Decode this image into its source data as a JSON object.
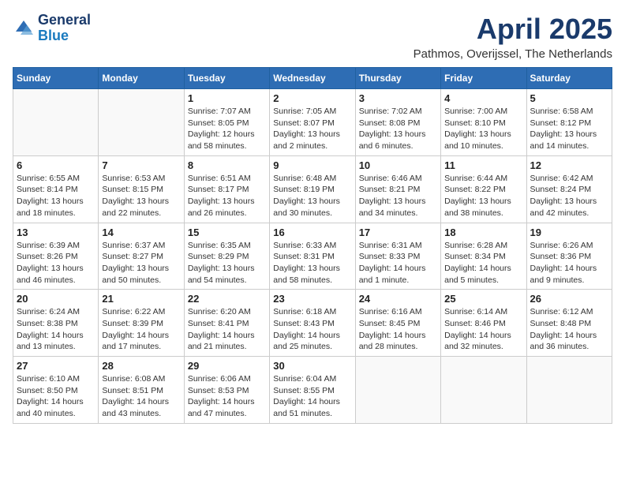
{
  "logo": {
    "line1": "General",
    "line2": "Blue"
  },
  "title": "April 2025",
  "subtitle": "Pathmos, Overijssel, The Netherlands",
  "weekdays": [
    "Sunday",
    "Monday",
    "Tuesday",
    "Wednesday",
    "Thursday",
    "Friday",
    "Saturday"
  ],
  "weeks": [
    [
      {
        "day": "",
        "info": ""
      },
      {
        "day": "",
        "info": ""
      },
      {
        "day": "1",
        "info": "Sunrise: 7:07 AM\nSunset: 8:05 PM\nDaylight: 12 hours and 58 minutes."
      },
      {
        "day": "2",
        "info": "Sunrise: 7:05 AM\nSunset: 8:07 PM\nDaylight: 13 hours and 2 minutes."
      },
      {
        "day": "3",
        "info": "Sunrise: 7:02 AM\nSunset: 8:08 PM\nDaylight: 13 hours and 6 minutes."
      },
      {
        "day": "4",
        "info": "Sunrise: 7:00 AM\nSunset: 8:10 PM\nDaylight: 13 hours and 10 minutes."
      },
      {
        "day": "5",
        "info": "Sunrise: 6:58 AM\nSunset: 8:12 PM\nDaylight: 13 hours and 14 minutes."
      }
    ],
    [
      {
        "day": "6",
        "info": "Sunrise: 6:55 AM\nSunset: 8:14 PM\nDaylight: 13 hours and 18 minutes."
      },
      {
        "day": "7",
        "info": "Sunrise: 6:53 AM\nSunset: 8:15 PM\nDaylight: 13 hours and 22 minutes."
      },
      {
        "day": "8",
        "info": "Sunrise: 6:51 AM\nSunset: 8:17 PM\nDaylight: 13 hours and 26 minutes."
      },
      {
        "day": "9",
        "info": "Sunrise: 6:48 AM\nSunset: 8:19 PM\nDaylight: 13 hours and 30 minutes."
      },
      {
        "day": "10",
        "info": "Sunrise: 6:46 AM\nSunset: 8:21 PM\nDaylight: 13 hours and 34 minutes."
      },
      {
        "day": "11",
        "info": "Sunrise: 6:44 AM\nSunset: 8:22 PM\nDaylight: 13 hours and 38 minutes."
      },
      {
        "day": "12",
        "info": "Sunrise: 6:42 AM\nSunset: 8:24 PM\nDaylight: 13 hours and 42 minutes."
      }
    ],
    [
      {
        "day": "13",
        "info": "Sunrise: 6:39 AM\nSunset: 8:26 PM\nDaylight: 13 hours and 46 minutes."
      },
      {
        "day": "14",
        "info": "Sunrise: 6:37 AM\nSunset: 8:27 PM\nDaylight: 13 hours and 50 minutes."
      },
      {
        "day": "15",
        "info": "Sunrise: 6:35 AM\nSunset: 8:29 PM\nDaylight: 13 hours and 54 minutes."
      },
      {
        "day": "16",
        "info": "Sunrise: 6:33 AM\nSunset: 8:31 PM\nDaylight: 13 hours and 58 minutes."
      },
      {
        "day": "17",
        "info": "Sunrise: 6:31 AM\nSunset: 8:33 PM\nDaylight: 14 hours and 1 minute."
      },
      {
        "day": "18",
        "info": "Sunrise: 6:28 AM\nSunset: 8:34 PM\nDaylight: 14 hours and 5 minutes."
      },
      {
        "day": "19",
        "info": "Sunrise: 6:26 AM\nSunset: 8:36 PM\nDaylight: 14 hours and 9 minutes."
      }
    ],
    [
      {
        "day": "20",
        "info": "Sunrise: 6:24 AM\nSunset: 8:38 PM\nDaylight: 14 hours and 13 minutes."
      },
      {
        "day": "21",
        "info": "Sunrise: 6:22 AM\nSunset: 8:39 PM\nDaylight: 14 hours and 17 minutes."
      },
      {
        "day": "22",
        "info": "Sunrise: 6:20 AM\nSunset: 8:41 PM\nDaylight: 14 hours and 21 minutes."
      },
      {
        "day": "23",
        "info": "Sunrise: 6:18 AM\nSunset: 8:43 PM\nDaylight: 14 hours and 25 minutes."
      },
      {
        "day": "24",
        "info": "Sunrise: 6:16 AM\nSunset: 8:45 PM\nDaylight: 14 hours and 28 minutes."
      },
      {
        "day": "25",
        "info": "Sunrise: 6:14 AM\nSunset: 8:46 PM\nDaylight: 14 hours and 32 minutes."
      },
      {
        "day": "26",
        "info": "Sunrise: 6:12 AM\nSunset: 8:48 PM\nDaylight: 14 hours and 36 minutes."
      }
    ],
    [
      {
        "day": "27",
        "info": "Sunrise: 6:10 AM\nSunset: 8:50 PM\nDaylight: 14 hours and 40 minutes."
      },
      {
        "day": "28",
        "info": "Sunrise: 6:08 AM\nSunset: 8:51 PM\nDaylight: 14 hours and 43 minutes."
      },
      {
        "day": "29",
        "info": "Sunrise: 6:06 AM\nSunset: 8:53 PM\nDaylight: 14 hours and 47 minutes."
      },
      {
        "day": "30",
        "info": "Sunrise: 6:04 AM\nSunset: 8:55 PM\nDaylight: 14 hours and 51 minutes."
      },
      {
        "day": "",
        "info": ""
      },
      {
        "day": "",
        "info": ""
      },
      {
        "day": "",
        "info": ""
      }
    ]
  ]
}
